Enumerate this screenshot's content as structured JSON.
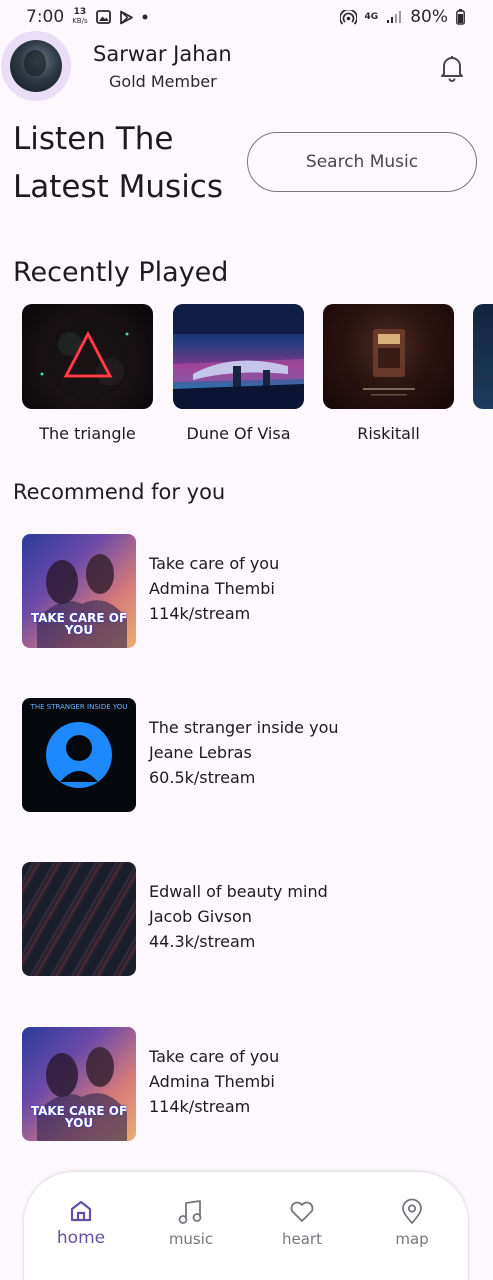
{
  "status_bar": {
    "time": "7:00",
    "net_speed_value": "13",
    "net_speed_unit": "KB/s",
    "network_type": "4G",
    "battery": "80%"
  },
  "user": {
    "name": "Sarwar Jahan",
    "tier": "Gold Member"
  },
  "hero": {
    "title_line1": "Listen The",
    "title_line2": "Latest Musics",
    "search_placeholder": "Search Music"
  },
  "recently_played": {
    "title": "Recently Played",
    "items": [
      {
        "label": "The triangle"
      },
      {
        "label": "Dune Of Visa"
      },
      {
        "label": "Riskitall"
      }
    ]
  },
  "recommend": {
    "title": "Recommend for you",
    "items": [
      {
        "title": "Take care of you",
        "artist": "Admina Thembi",
        "streams": "114k/stream",
        "cover_text": "TAKE CARE OF YOU"
      },
      {
        "title": "The stranger inside you",
        "artist": "Jeane Lebras",
        "streams": "60.5k/stream",
        "cover_text": "THE STRANGER INSIDE YOU"
      },
      {
        "title": "Edwall of beauty mind",
        "artist": "Jacob Givson",
        "streams": "44.3k/stream"
      },
      {
        "title": "Take care of you",
        "artist": "Admina Thembi",
        "streams": "114k/stream",
        "cover_text": "TAKE CARE OF YOU"
      }
    ]
  },
  "nav": {
    "items": [
      {
        "label": "home",
        "icon": "home-icon",
        "active": true
      },
      {
        "label": "music",
        "icon": "music-note-icon",
        "active": false
      },
      {
        "label": "heart",
        "icon": "heart-icon",
        "active": false
      },
      {
        "label": "map",
        "icon": "map-pin-icon",
        "active": false
      }
    ]
  },
  "colors": {
    "background": "#FDF8FD",
    "accent": "#6750A4",
    "avatar_ring": "#E9DEF6",
    "nav_inactive": "#79747E"
  }
}
